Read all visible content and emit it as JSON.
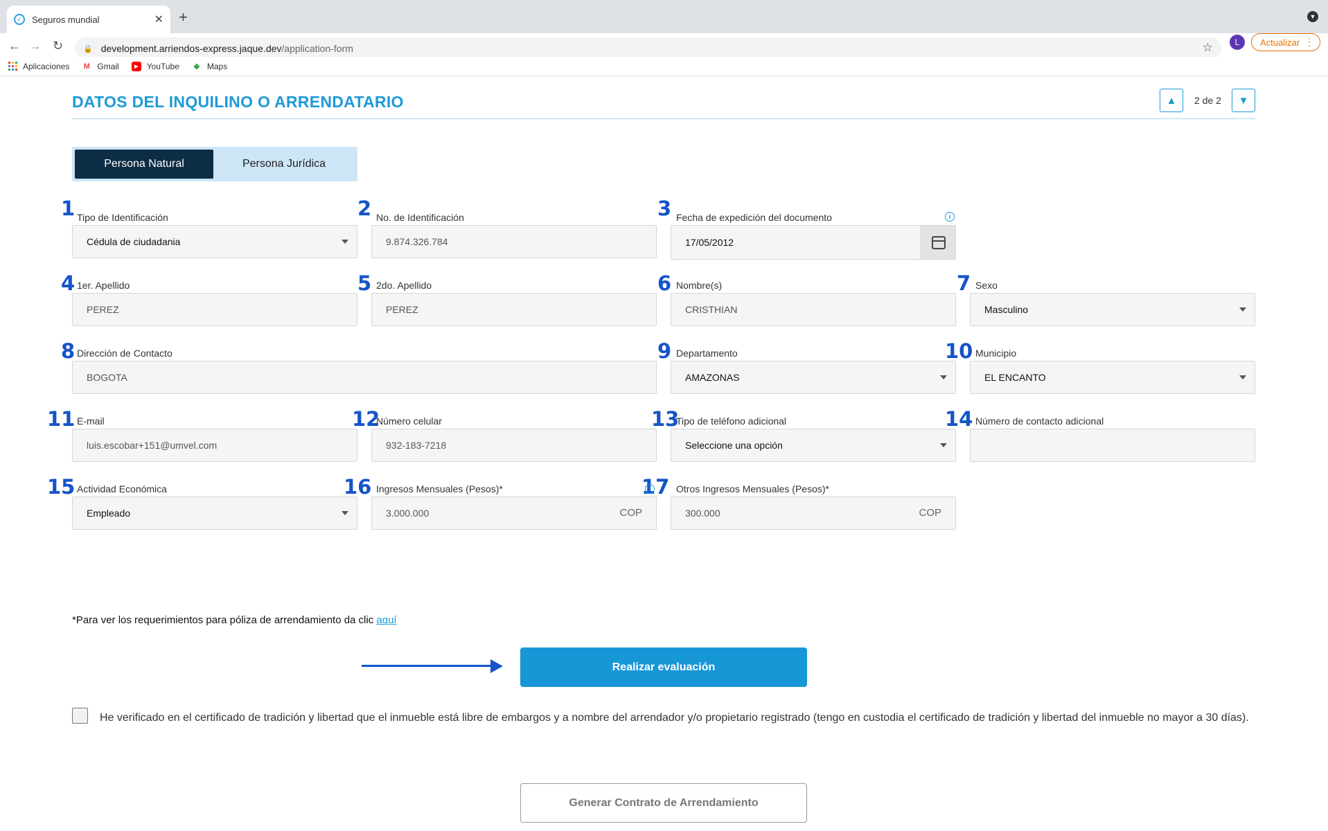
{
  "browser": {
    "tab_title": "Seguros mundial",
    "url_host": "development.arriendos-express.jaque.dev",
    "url_path": "/application-form",
    "profile_initial": "L",
    "update_label": "Actualizar",
    "bookmarks": [
      "Aplicaciones",
      "Gmail",
      "YouTube",
      "Maps"
    ]
  },
  "section": {
    "title": "DATOS DEL INQUILINO O ARRENDATARIO",
    "pager": "2 de 2"
  },
  "person_type": {
    "natural": "Persona Natural",
    "juridica": "Persona Jurídica"
  },
  "annotations": [
    "1",
    "2",
    "3",
    "4",
    "5",
    "6",
    "7",
    "8",
    "9",
    "10",
    "11",
    "12",
    "13",
    "14",
    "15",
    "16",
    "17"
  ],
  "fields": {
    "tipo_id": {
      "label": "Tipo de Identificación",
      "value": "Cédula de ciudadania"
    },
    "no_id": {
      "label": "No. de Identificación",
      "value": "9.874.326.784"
    },
    "fecha_exp": {
      "label": "Fecha de expedición del documento",
      "value": "17/05/2012"
    },
    "apellido1": {
      "label": "1er. Apellido",
      "value": "PEREZ"
    },
    "apellido2": {
      "label": "2do. Apellido",
      "value": "PEREZ"
    },
    "nombres": {
      "label": "Nombre(s)",
      "value": "CRISTHIAN"
    },
    "sexo": {
      "label": "Sexo",
      "value": "Masculino"
    },
    "direccion": {
      "label": "Dirección de Contacto",
      "value": "BOGOTA"
    },
    "departamento": {
      "label": "Departamento",
      "value": "AMAZONAS"
    },
    "municipio": {
      "label": "Municipio",
      "value": "EL ENCANTO"
    },
    "email": {
      "label": "E-mail",
      "value": "luis.escobar+151@umvel.com"
    },
    "celular": {
      "label": "Número celular",
      "value": "932-183-7218"
    },
    "tipo_tel": {
      "label": "Tipo de teléfono adicional",
      "value": "Seleccione una opción"
    },
    "contacto_adicional": {
      "label": "Número de contacto adicional",
      "value": ""
    },
    "actividad": {
      "label": "Actividad Económica",
      "value": "Empleado"
    },
    "ingresos": {
      "label": "Ingresos Mensuales (Pesos)*",
      "value": "3.000.000",
      "suffix": "COP"
    },
    "otros_ingresos": {
      "label": "Otros Ingresos Mensuales (Pesos)*",
      "value": "300.000",
      "suffix": "COP"
    }
  },
  "requirements": {
    "text": "*Para ver los requerimientos para póliza de arrendamiento da clic ",
    "link": "aquí"
  },
  "eval_button": "Realizar evaluación",
  "checkbox_text": "He verificado en el certificado de tradición y libertad que el inmueble está libre de embargos y a nombre del arrendador y/o propietario registrado (tengo en custodia el certificado de tradición y libertad del inmueble no mayor a 30 días).",
  "contract_button": "Generar Contrato de Arrendamiento",
  "colors": {
    "accent": "#1e9ad6",
    "dark_navy": "#0d2d45",
    "annotation_blue": "#1554c9"
  }
}
